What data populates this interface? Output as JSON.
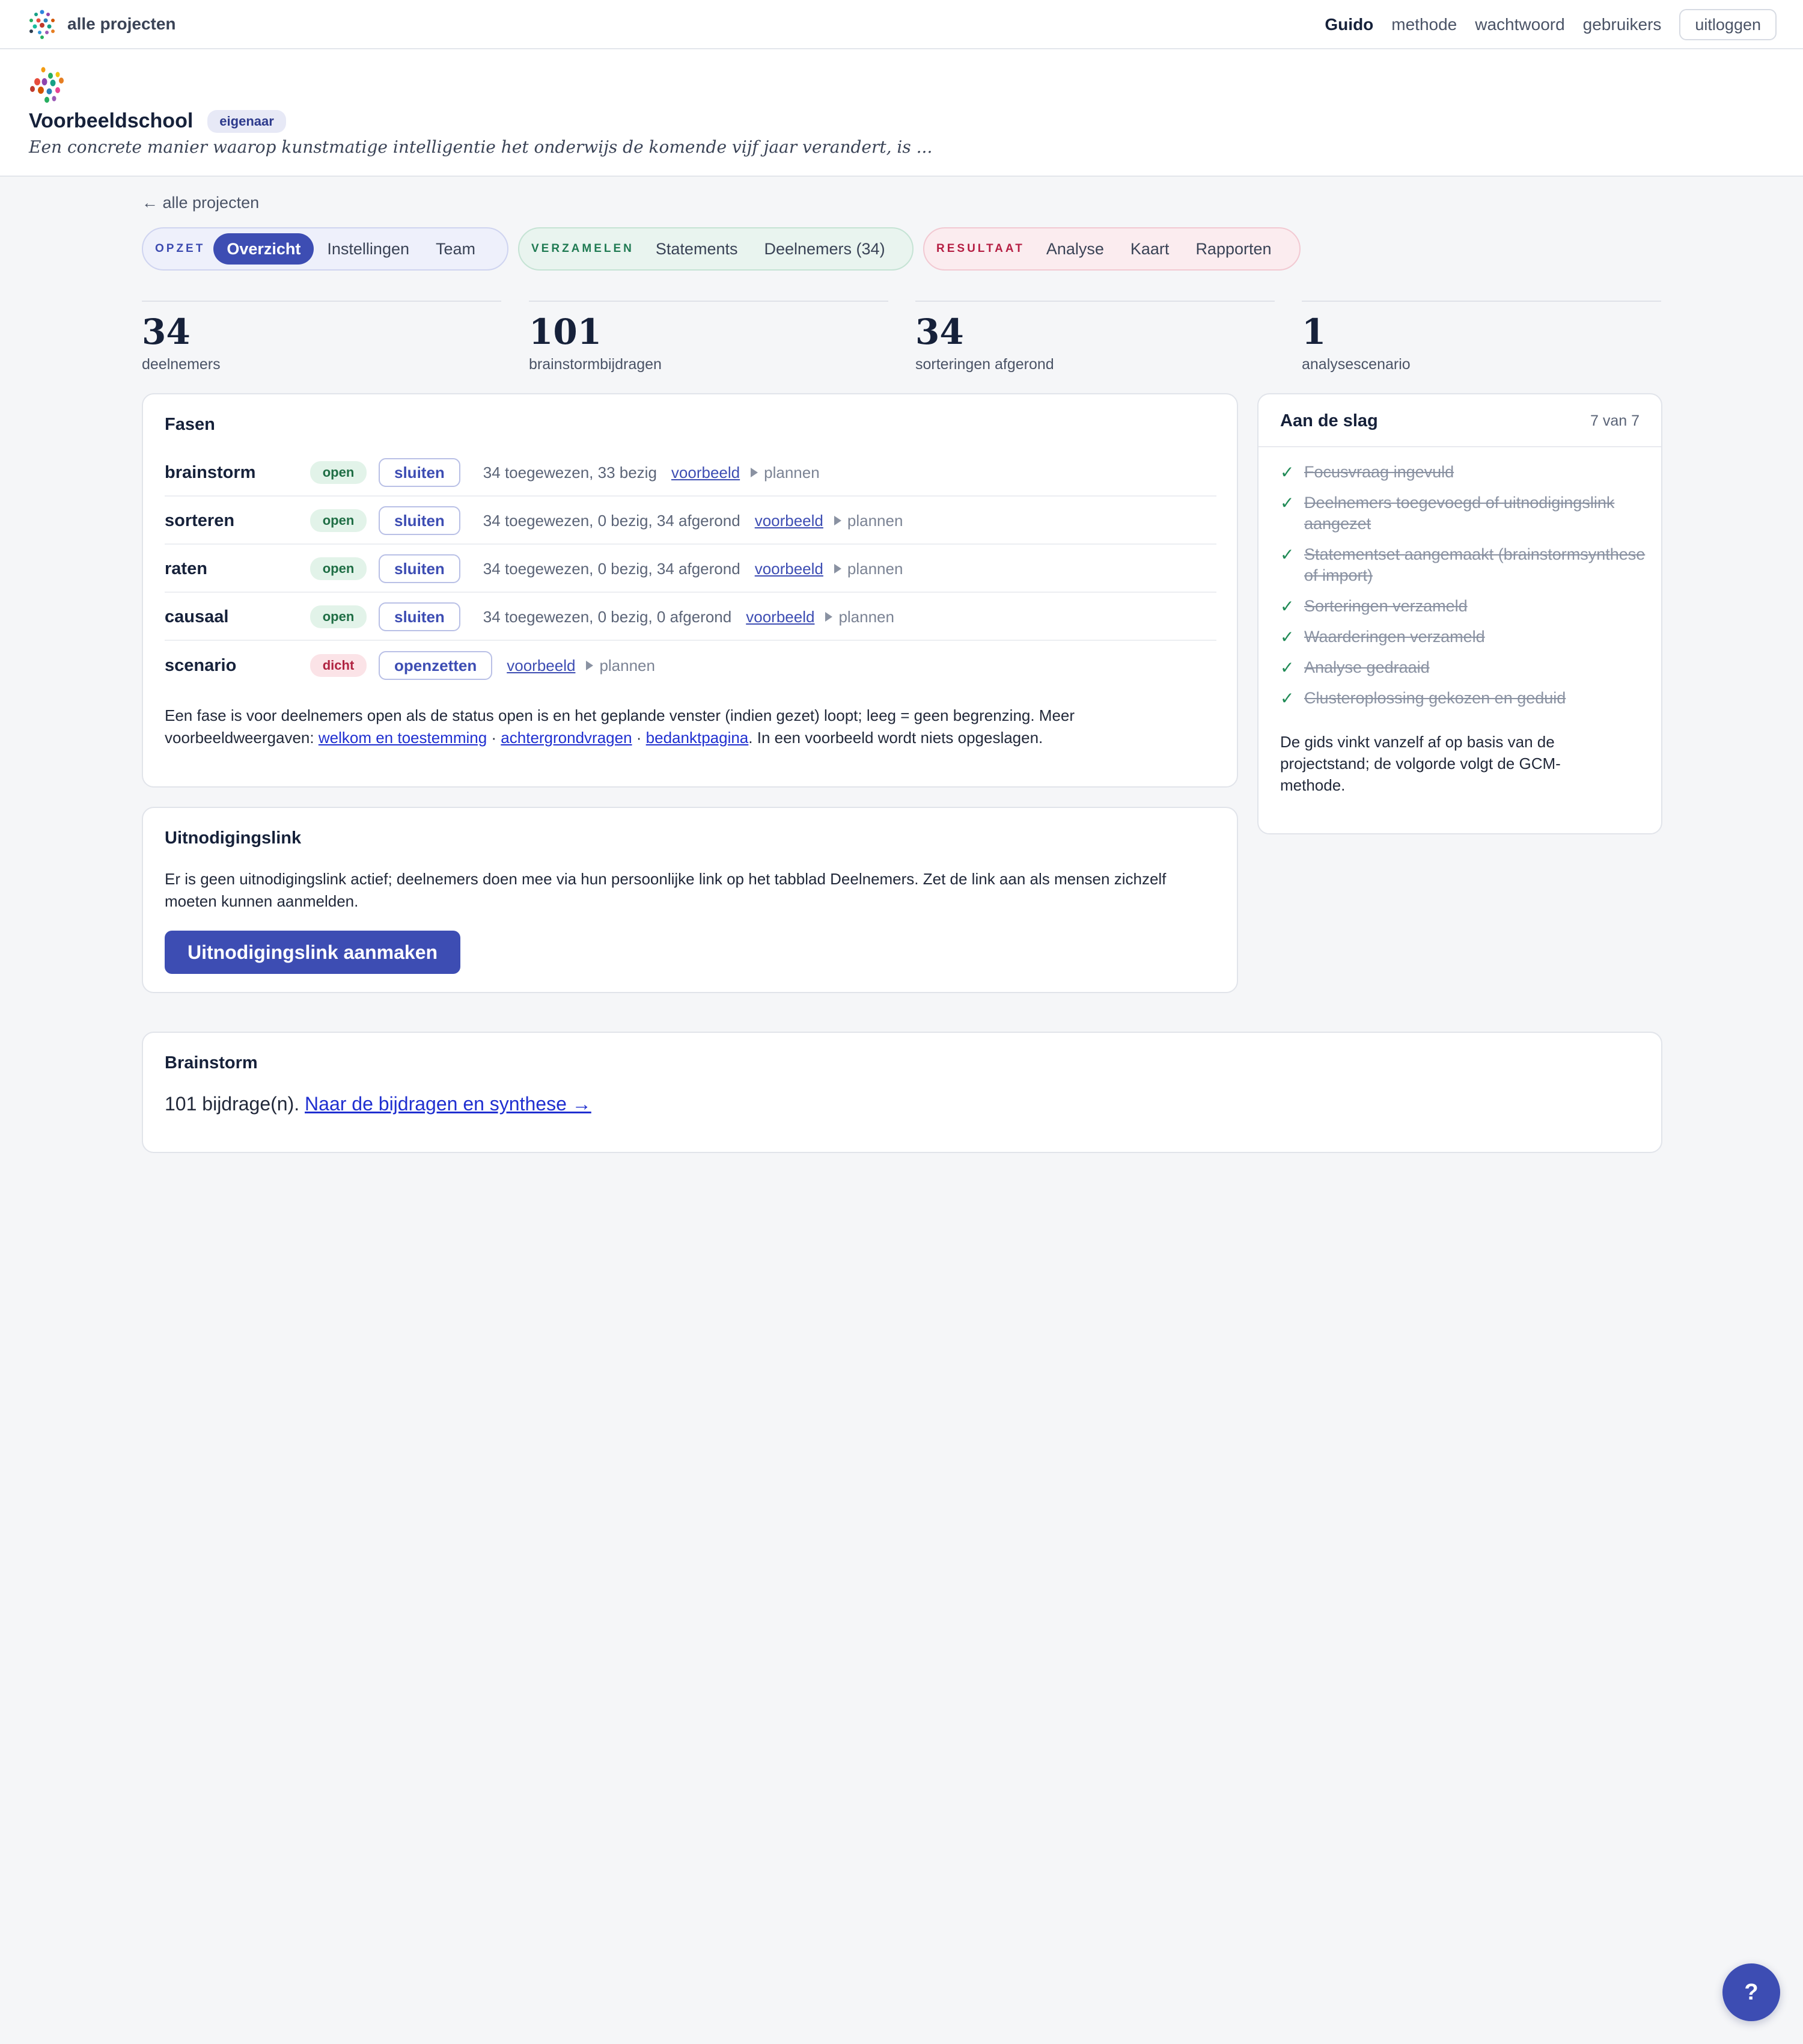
{
  "topnav": {
    "brand": "alle projecten",
    "user": "Guido",
    "links": [
      "methode",
      "wachtwoord",
      "gebruikers"
    ],
    "logout": "uitloggen"
  },
  "project": {
    "name": "Voorbeeldschool",
    "role_badge": "eigenaar",
    "focus_question": "Een concrete manier waarop kunstmatige intelligentie het onderwijs de komende vijf jaar verandert, is ..."
  },
  "back_link": "← alle projecten",
  "tabgroups": [
    {
      "label": "OPZET",
      "tabs": [
        "Overzicht",
        "Instellingen",
        "Team"
      ],
      "active": "Overzicht"
    },
    {
      "label": "VERZAMELEN",
      "tabs": [
        "Statements",
        "Deelnemers (34)"
      ]
    },
    {
      "label": "RESULTAAT",
      "tabs": [
        "Analyse",
        "Kaart",
        "Rapporten"
      ]
    }
  ],
  "stats": [
    {
      "value": "34",
      "label": "deelnemers"
    },
    {
      "value": "101",
      "label": "brainstormbijdragen"
    },
    {
      "value": "34",
      "label": "sorteringen afgerond"
    },
    {
      "value": "1",
      "label": "analysescenario"
    }
  ],
  "phases": {
    "title": "Fasen",
    "preview_label": "voorbeeld",
    "plan_label": "plannen",
    "rows": [
      {
        "name": "brainstorm",
        "status": "open",
        "action": "sluiten",
        "info": "34 toegewezen, 33 bezig"
      },
      {
        "name": "sorteren",
        "status": "open",
        "action": "sluiten",
        "info": "34 toegewezen, 0 bezig, 34 afgerond"
      },
      {
        "name": "raten",
        "status": "open",
        "action": "sluiten",
        "info": "34 toegewezen, 0 bezig, 34 afgerond"
      },
      {
        "name": "causaal",
        "status": "open",
        "action": "sluiten",
        "info": "34 toegewezen, 0 bezig, 0 afgerond"
      },
      {
        "name": "scenario",
        "status": "dicht",
        "action": "openzetten",
        "info": ""
      }
    ],
    "note_prefix": "Een fase is voor deelnemers open als de status open is en het geplande venster (indien gezet) loopt; leeg = geen begrenzing. Meer voorbeeldweergaven: ",
    "note_links": [
      "welkom en toestemming",
      "achtergrondvragen",
      "bedanktpagina"
    ],
    "note_separator": " · ",
    "note_suffix": ". In een voorbeeld wordt niets opgeslagen."
  },
  "invite": {
    "title": "Uitnodigingslink",
    "text": "Er is geen uitnodigingslink actief; deelnemers doen mee via hun persoonlijke link op het tabblad Deelnemers. Zet de link aan als mensen zichzelf moeten kunnen aanmelden.",
    "button": "Uitnodigingslink aanmaken"
  },
  "guide": {
    "title": "Aan de slag",
    "count": "7 van 7",
    "items": [
      "Focusvraag ingevuld",
      "Deelnemers toegevoegd of uitnodigingslink aangezet",
      "Statementset aangemaakt (brainstormsynthese of import)",
      "Sorteringen verzameld",
      "Waarderingen verzameld",
      "Analyse gedraaid",
      "Clusteroplossing gekozen en geduid"
    ],
    "check_glyph": "✓",
    "note": "De gids vinkt vanzelf af op basis van de projectstand; de volgorde volgt de GCM-methode."
  },
  "brainstorm": {
    "title": "Brainstorm",
    "text": "101 bijdrage(n). ",
    "link": "Naar de bijdragen en synthese →"
  },
  "help": "?",
  "colors": {
    "accent": "#3d4db3",
    "opzet": "#3c4ab0",
    "verzamelen": "#1f7a52",
    "resultaat": "#b51e43",
    "check": "#1f8a55"
  }
}
